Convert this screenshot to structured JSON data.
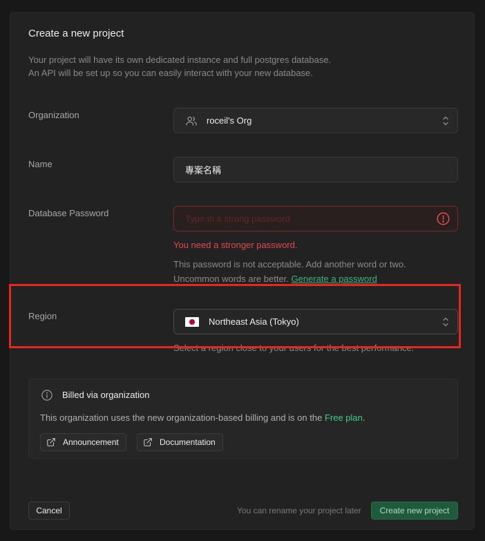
{
  "dialog": {
    "title": "Create a new project",
    "description_line1": "Your project will have its own dedicated instance and full postgres database.",
    "description_line2": "An API will be set up so you can easily interact with your new database."
  },
  "organization": {
    "label": "Organization",
    "value": "roceil's Org",
    "icon": "users-icon"
  },
  "name": {
    "label": "Name",
    "value": "專案名稱"
  },
  "password": {
    "label": "Database Password",
    "placeholder": "Type in a strong password",
    "error": "You need a stronger password.",
    "hint_line1": "This password is not acceptable. Add another word or two.",
    "hint_line2": "Uncommon words are better.",
    "generate_link": "Generate a password",
    "error_color": "#e5484d"
  },
  "region": {
    "label": "Region",
    "value": "Northeast Asia (Tokyo)",
    "flag": "japan-flag",
    "hint": "Select a region close to your users for the best performance.",
    "highlight_color": "#e8261c"
  },
  "billing": {
    "title": "Billed via organization",
    "text": "This organization uses the new organization-based billing and is on the",
    "plan": "Free plan",
    "period": ".",
    "announcement_label": "Announcement",
    "documentation_label": "Documentation"
  },
  "footer": {
    "cancel_label": "Cancel",
    "rename_note": "You can rename your project later",
    "create_label": "Create new project",
    "accent": "#3ecf8e"
  }
}
